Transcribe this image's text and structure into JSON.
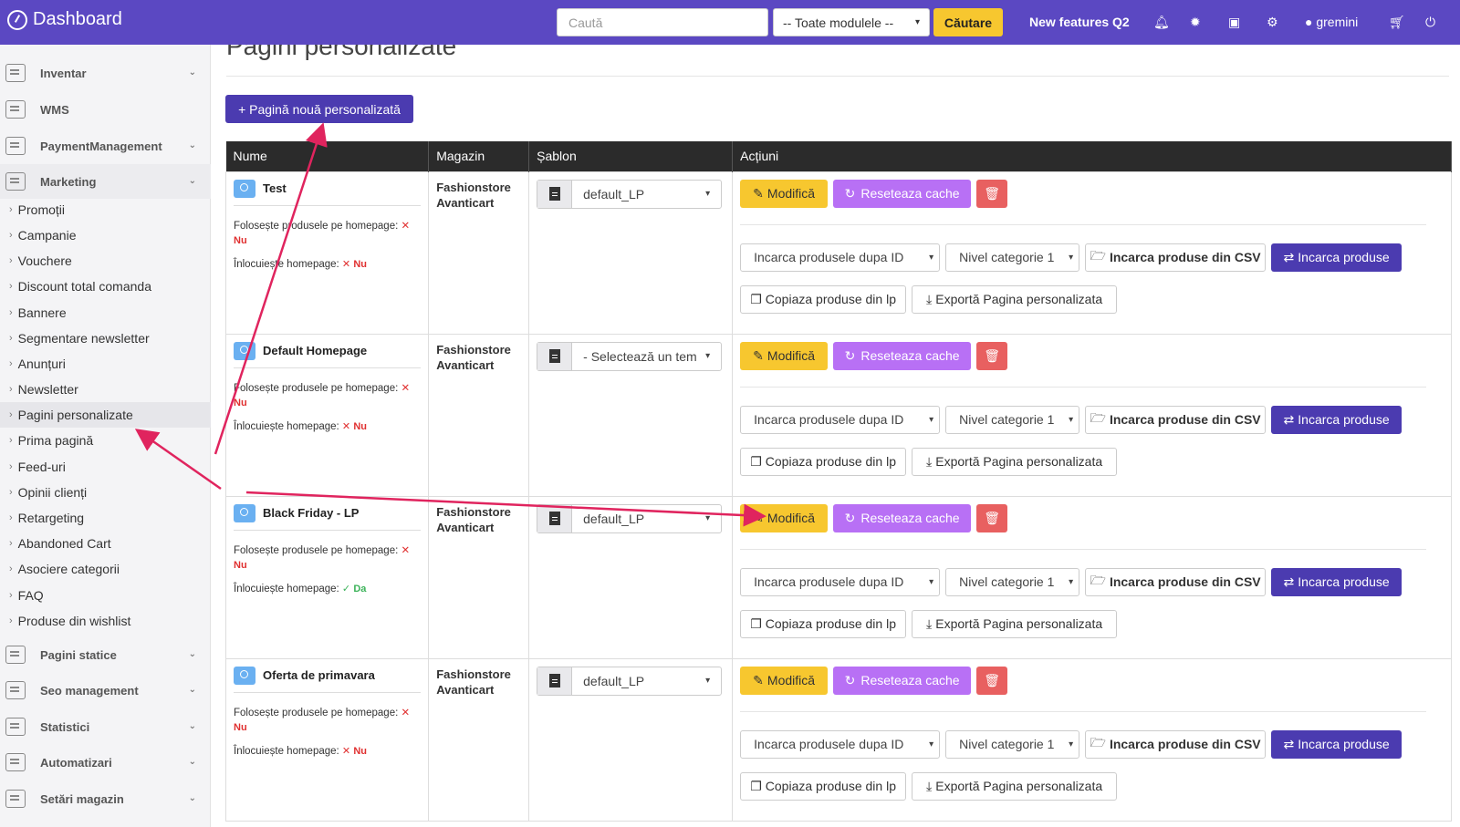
{
  "topbar": {
    "brand": "Dashboard",
    "search_placeholder": "Caută",
    "module_select": "-- Toate modulele --",
    "search_button": "Căutare",
    "features_link": "New features Q2",
    "user": "gremini"
  },
  "sidebar": {
    "inventar": "Inventar",
    "wms": "WMS",
    "payment": "PaymentManagement",
    "marketing": "Marketing",
    "marketing_items": [
      "Promoții",
      "Campanie",
      "Vouchere",
      "Discount total comanda",
      "Bannere",
      "Segmentare newsletter",
      "Anunțuri",
      "Newsletter",
      "Pagini personalizate",
      "Prima pagină",
      "Feed-uri",
      "Opinii clienți",
      "Retargeting",
      "Abandoned Cart",
      "Asociere categorii",
      "FAQ",
      "Produse din wishlist"
    ],
    "pagini_statice": "Pagini statice",
    "seo": "Seo management",
    "statistici": "Statistici",
    "automatizari": "Automatizari",
    "setari": "Setări magazin"
  },
  "page": {
    "title": "Pagini personalizate",
    "new_button": "+ Pagină nouă personalizată"
  },
  "table": {
    "headers": [
      "Nume",
      "Magazin",
      "Șablon",
      "Acțiuni"
    ],
    "flag_products_label": "Folosește produsele pe homepage:",
    "flag_replace_label": "Înlocuiește homepage:",
    "no": "Nu",
    "yes": "Da",
    "shop": "Fashionstore Avanticart",
    "rows": [
      {
        "name": "Test",
        "template": "default_LP",
        "replace": "Nu"
      },
      {
        "name": "Default Homepage",
        "template": "- Selectează un tem",
        "replace": "Nu"
      },
      {
        "name": "Black Friday - LP",
        "template": "default_LP",
        "replace": "Da"
      },
      {
        "name": "Oferta de primavara",
        "template": "default_LP",
        "replace": "Nu"
      }
    ],
    "actions": {
      "edit": "Modifică",
      "reset_cache": "Reseteaza cache",
      "load_by": "Incarca produsele dupa ID",
      "level": "Nivel categorie 1",
      "load_csv": "Incarca produse din CSV",
      "load_products": "Incarca produse",
      "copy": "Copiaza produse din lp",
      "export": "Exportă Pagina personalizata"
    }
  },
  "colors": {
    "topbar": "#5b48c2",
    "accent_yellow": "#f7c72f",
    "purple": "#b870f5",
    "indigo": "#4b3bb0",
    "danger": "#e86060",
    "annotation_arrow": "#e0245e"
  }
}
